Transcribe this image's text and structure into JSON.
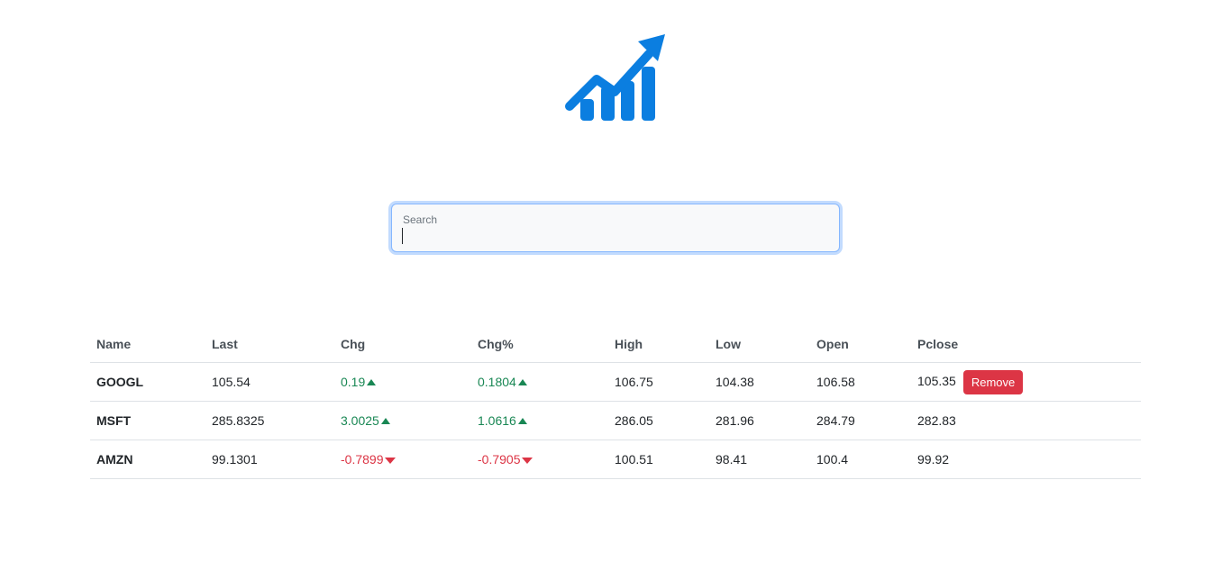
{
  "logo": {
    "icon": "chart-line-up-icon",
    "color": "#0b7ee0"
  },
  "search": {
    "label": "Search",
    "value": "",
    "placeholder": ""
  },
  "table": {
    "columns": [
      "Name",
      "Last",
      "Chg",
      "Chg%",
      "High",
      "Low",
      "Open",
      "Pclose"
    ],
    "rows": [
      {
        "name": "GOOGL",
        "last": "105.54",
        "chg": "0.19",
        "chg_pct": "0.1804",
        "direction": "up",
        "high": "106.75",
        "low": "104.38",
        "open": "106.58",
        "pclose": "105.35",
        "action": "Remove"
      },
      {
        "name": "MSFT",
        "last": "285.8325",
        "chg": "3.0025",
        "chg_pct": "1.0616",
        "direction": "up",
        "high": "286.05",
        "low": "281.96",
        "open": "284.79",
        "pclose": "282.83"
      },
      {
        "name": "AMZN",
        "last": "99.1301",
        "chg": "-0.7899",
        "chg_pct": "-0.7905",
        "direction": "down",
        "high": "100.51",
        "low": "98.41",
        "open": "100.4",
        "pclose": "99.92"
      }
    ]
  },
  "colors": {
    "up": "#198754",
    "down": "#dc3545",
    "remove_button": "#dc3545",
    "focus_border": "#86b7fe"
  }
}
